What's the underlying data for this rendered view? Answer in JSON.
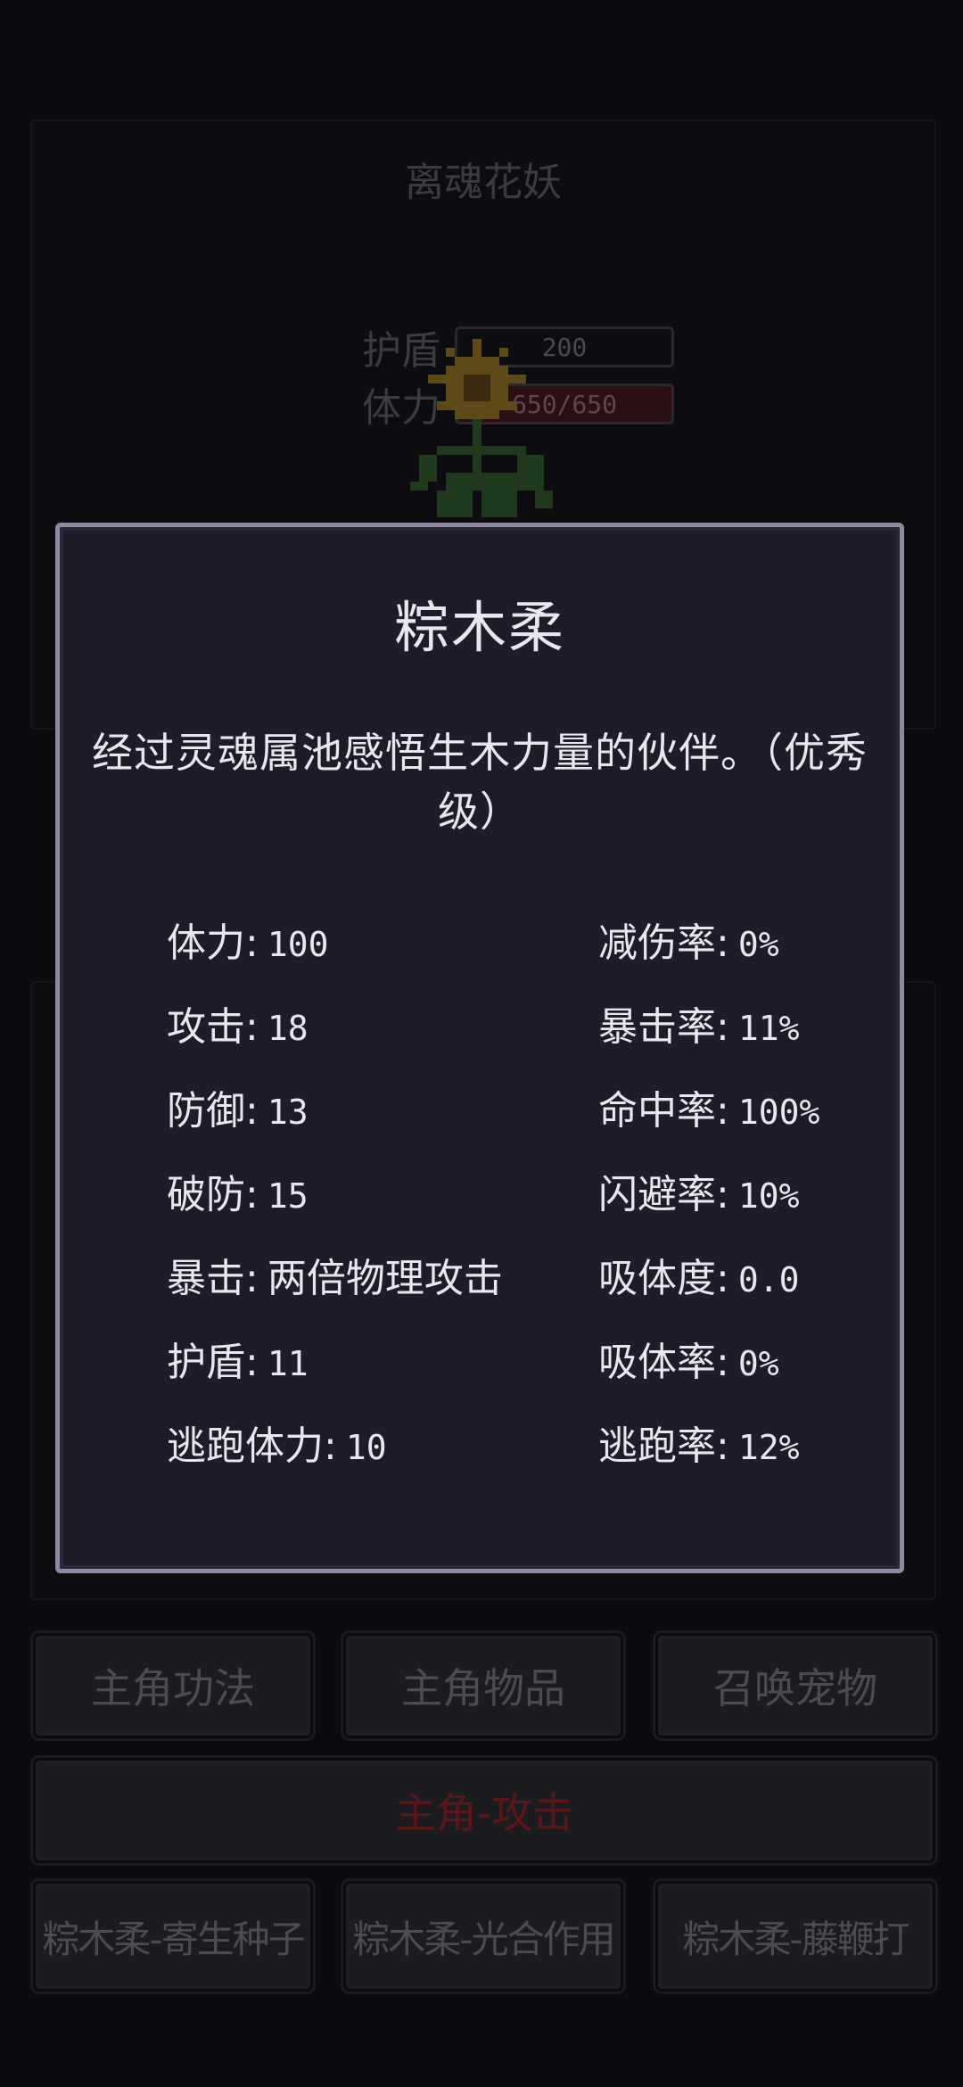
{
  "enemy": {
    "name": "离魂花妖",
    "shield_label": "护盾",
    "shield_value": "200",
    "hp_label": "体力",
    "hp_value": "650/650"
  },
  "dialog": {
    "title": "粽木柔",
    "description": "经过灵魂属池感悟生木力量的伙伴。（优秀级）",
    "left_stats": [
      {
        "label": "体力",
        "value": "100"
      },
      {
        "label": "攻击",
        "value": "18"
      },
      {
        "label": "防御",
        "value": "13"
      },
      {
        "label": "破防",
        "value": "15"
      },
      {
        "label": "暴击",
        "value": "两倍物理攻击"
      },
      {
        "label": "护盾",
        "value": "11"
      },
      {
        "label": "逃跑体力",
        "value": "10"
      }
    ],
    "right_stats": [
      {
        "label": "减伤率",
        "value": "0%"
      },
      {
        "label": "暴击率",
        "value": "11%"
      },
      {
        "label": "命中率",
        "value": "100%"
      },
      {
        "label": "闪避率",
        "value": "10%"
      },
      {
        "label": "吸体度",
        "value": "0.0"
      },
      {
        "label": "吸体率",
        "value": "0%"
      },
      {
        "label": "逃跑率",
        "value": "12%"
      }
    ]
  },
  "actions": {
    "skills": "主角功法",
    "items": "主角物品",
    "summon_pet": "召唤宠物",
    "attack": "主角-攻击",
    "pet_skill_1": "粽木柔-寄生种子",
    "pet_skill_2": "粽木柔-光合作用",
    "pet_skill_3": "粽木柔-藤鞭打"
  },
  "colors": {
    "background": "#0b0a0f",
    "dialog_bg": "#1f1b2a",
    "dialog_border": "#8d8aa2",
    "attack_text": "#5a1717"
  }
}
